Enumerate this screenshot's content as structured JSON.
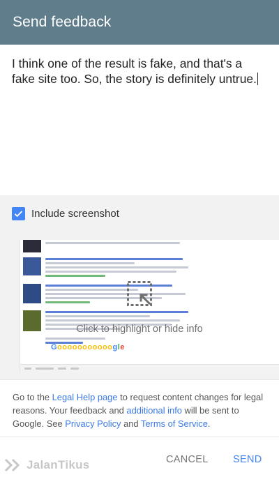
{
  "header": {
    "title": "Send feedback"
  },
  "feedback": {
    "text": "I think one of the result is fake, and that's a fake site too. So, the story is definitely untrue."
  },
  "screenshot": {
    "label": "Include screenshot",
    "checked": true
  },
  "preview": {
    "highlight_hint": "Click to highlight or hide info"
  },
  "legal": {
    "p1": "Go to the ",
    "legal_help_link": "Legal Help page",
    "p2": " to request content changes for legal reasons. Your feedback and ",
    "additional_info_link": "additional info",
    "p3": " will be sent to Google. See ",
    "privacy_link": "Privacy Policy",
    "p4": " and ",
    "terms_link": "Terms of Service",
    "p5": "."
  },
  "footer": {
    "cancel_label": "CANCEL",
    "send_label": "SEND"
  },
  "watermark": {
    "brand": "JalanTikus"
  },
  "colors": {
    "header": "#607d8b",
    "accent": "#4285f4",
    "link": "#3b78e7"
  }
}
